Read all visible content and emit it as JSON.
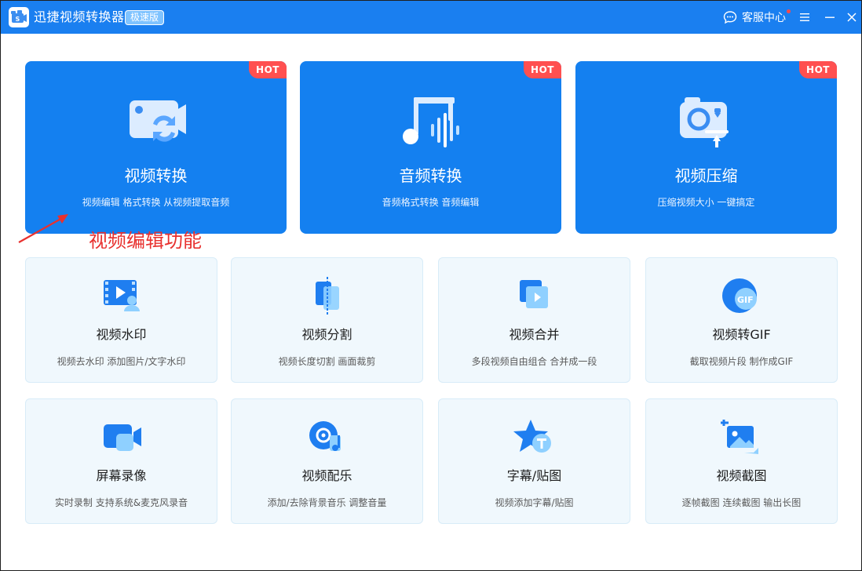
{
  "app": {
    "title": "迅捷视频转换器",
    "edition": "极速版",
    "support_label": "客服中心"
  },
  "colors": {
    "titlebar": "#1a7ff0",
    "big_card": "#1480f0",
    "hot_badge": "#ff5050",
    "small_card_bg": "#f0f8fd",
    "annotation": "#e8312f"
  },
  "big_cards": [
    {
      "title": "视频转换",
      "desc": "视频编辑 格式转换 从视频提取音频",
      "badge": "HOT",
      "icon": "video-convert-icon"
    },
    {
      "title": "音频转换",
      "desc": "音频格式转换 音频编辑",
      "badge": "HOT",
      "icon": "audio-convert-icon"
    },
    {
      "title": "视频压缩",
      "desc": "压缩视频大小 一键搞定",
      "badge": "HOT",
      "icon": "video-compress-icon"
    }
  ],
  "annotation": {
    "text": "视频编辑功能"
  },
  "small_cards": [
    {
      "title": "视频水印",
      "desc": "视频去水印 添加图片/文字水印",
      "icon": "watermark-icon"
    },
    {
      "title": "视频分割",
      "desc": "视频长度切割 画面裁剪",
      "icon": "split-icon"
    },
    {
      "title": "视频合并",
      "desc": "多段视频自由组合 合并成一段",
      "icon": "merge-icon"
    },
    {
      "title": "视频转GIF",
      "desc": "截取视频片段 制作成GIF",
      "icon": "gif-icon"
    },
    {
      "title": "屏幕录像",
      "desc": "实时录制 支持系统&麦克风录音",
      "icon": "screen-record-icon"
    },
    {
      "title": "视频配乐",
      "desc": "添加/去除背景音乐 调整音量",
      "icon": "music-icon"
    },
    {
      "title": "字幕/贴图",
      "desc": "视频添加字幕/贴图",
      "icon": "subtitle-icon"
    },
    {
      "title": "视频截图",
      "desc": "逐帧截图 连续截图 输出长图",
      "icon": "screenshot-icon"
    }
  ]
}
